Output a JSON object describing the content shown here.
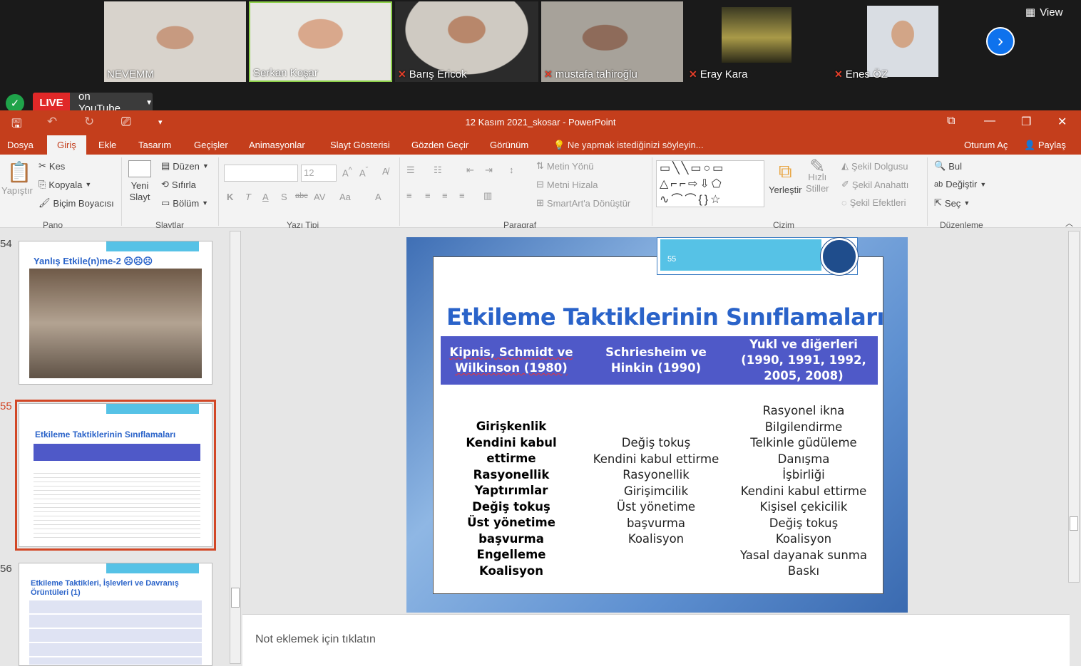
{
  "zoom": {
    "participants": [
      {
        "name": "NEVEMM",
        "muted": false
      },
      {
        "name": "Serkan Koşar",
        "muted": false
      },
      {
        "name": "Barış Ericok",
        "muted": true
      },
      {
        "name": "mustafa tahiroğlu",
        "muted": true
      },
      {
        "name": "Eray Kara",
        "muted": true
      },
      {
        "name": "Enes ÖZ",
        "muted": true
      }
    ],
    "view_label": "View",
    "live_label": "LIVE",
    "stream_target": "on YouTube"
  },
  "window": {
    "title": "12 Kasım 2021_skosar  -  PowerPoint",
    "signin": "Oturum Aç",
    "share": "Paylaş"
  },
  "tabs": [
    "Dosya",
    "Giriş",
    "Ekle",
    "Tasarım",
    "Geçişler",
    "Animasyonlar",
    "Slayt Gösterisi",
    "Gözden Geçir",
    "Görünüm"
  ],
  "tell_me": "Ne yapmak istediğinizi söyleyin...",
  "ribbon": {
    "pano": {
      "paste": "Yapıştır",
      "cut": "Kes",
      "copy": "Kopyala",
      "format_painter": "Biçim Boyacısı",
      "label": "Pano"
    },
    "slaytlar": {
      "new_slide_1": "Yeni",
      "new_slide_2": "Slayt",
      "layout": "Düzen",
      "reset": "Sıfırla",
      "section": "Bölüm",
      "label": "Slaytlar"
    },
    "font": {
      "size": "12",
      "label": "Yazı Tipi"
    },
    "paragraf": {
      "text_direction": "Metin Yönü",
      "align_text": "Metni Hizala",
      "smartart": "SmartArt'a Dönüştür",
      "label": "Paragraf"
    },
    "cizim": {
      "arrange": "Yerleştir",
      "quick_styles_1": "Hızlı",
      "quick_styles_2": "Stiller",
      "fill": "Şekil Dolgusu",
      "outline": "Şekil Anahattı",
      "effects": "Şekil Efektleri",
      "label": "Çizim"
    },
    "duzenleme": {
      "find": "Bul",
      "replace": "Değiştir",
      "select": "Seç",
      "label": "Düzenleme"
    }
  },
  "thumbnails": [
    {
      "number": "54",
      "title": "Yanlış Etkile(n)me-2 ☹☹☹"
    },
    {
      "number": "55",
      "title": "Etkileme Taktiklerinin Sınıflamaları"
    },
    {
      "number": "56",
      "title": "Etkileme Taktikleri, İşlevleri ve Davranış Örüntüleri (1)"
    }
  ],
  "slide": {
    "number": "55",
    "title": "Etkileme Taktiklerinin Sınıflamaları",
    "headers": [
      "Kipnis, Schmidt ve Wilkinson (1980)",
      "Schriesheim ve Hinkin (1990)",
      "Yukl ve diğerleri (1990, 1991, 1992, 2005, 2008)"
    ],
    "col1": [
      "Girişkenlik",
      "Kendini kabul ettirme",
      "Rasyonellik",
      "Yaptırımlar",
      "Değiş tokuş",
      "Üst yönetime",
      "başvurma",
      "Engelleme",
      "Koalisyon"
    ],
    "col2": [
      "Değiş tokuş",
      "Kendini kabul ettirme",
      "Rasyonellik",
      "Girişimcilik",
      "Üst yönetime",
      "başvurma",
      "Koalisyon"
    ],
    "col3": [
      "Rasyonel ikna",
      "Bilgilendirme",
      "Telkinle güdüleme",
      "Danışma",
      "İşbirliği",
      "Kendini kabul ettirme",
      "Kişisel çekicilik",
      "Değiş tokuş",
      "Koalisyon",
      "Yasal dayanak sunma",
      "Baskı"
    ]
  },
  "notes_placeholder": "Not eklemek için tıklatın"
}
